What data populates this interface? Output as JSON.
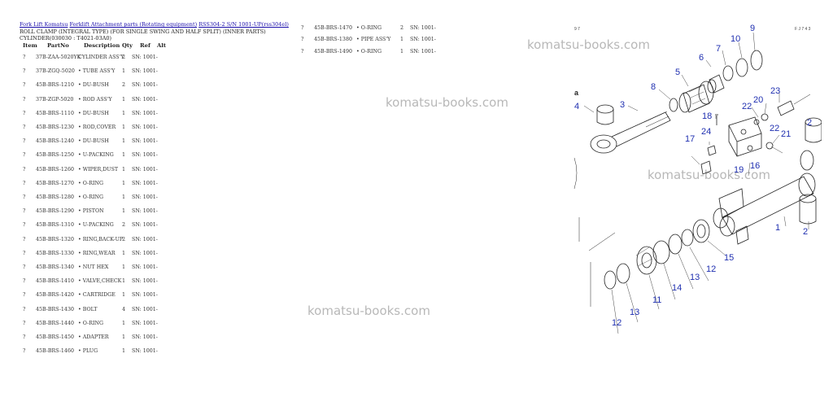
{
  "breadcrumb": [
    {
      "text": "Fork Lift Komatsu"
    },
    {
      "text": "Forklift Attachment parts (Rotating equipment)"
    },
    {
      "text": "RSS304-2 S/N 1001-UP(rss304el)"
    }
  ],
  "title_lines": [
    "ROLL CLAMP (INTEGRAL TYPE) (FOR SINGLE SWING AND HALF SPLIT) (INNER PARTS)",
    "CYLINDER(030030 : T4021-03A0)"
  ],
  "headers": {
    "item": "Item",
    "partno": "PartNo",
    "desc": "Description",
    "qty": "Qty",
    "ref": "Ref",
    "alt": "Alt"
  },
  "parts_left": [
    {
      "item": "?",
      "partno": "37B-ZAA-5020YK",
      "desc": "CYLINDER ASS'Y",
      "qty": "2",
      "ref": "SN: 1001-"
    },
    {
      "item": "?",
      "partno": "37B-ZGQ-5020",
      "desc": "• TUBE ASS'Y",
      "qty": "1",
      "ref": "SN: 1001-"
    },
    {
      "item": "?",
      "partno": "45B-BRS-1210",
      "desc": "• DU-BUSH",
      "qty": "2",
      "ref": "SN: 1001-"
    },
    {
      "item": "?",
      "partno": "37B-ZGP-5020",
      "desc": "• ROD ASS'Y",
      "qty": "1",
      "ref": "SN: 1001-"
    },
    {
      "item": "?",
      "partno": "45B-BRS-1110",
      "desc": "• DU-BUSH",
      "qty": "1",
      "ref": "SN: 1001-"
    },
    {
      "item": "?",
      "partno": "45B-BRS-1230",
      "desc": "• ROD,COVER",
      "qty": "1",
      "ref": "SN: 1001-"
    },
    {
      "item": "?",
      "partno": "45B-BRS-1240",
      "desc": "• DU-BUSH",
      "qty": "1",
      "ref": "SN: 1001-"
    },
    {
      "item": "?",
      "partno": "45B-BRS-1250",
      "desc": "• U-PACKING",
      "qty": "1",
      "ref": "SN: 1001-"
    },
    {
      "item": "?",
      "partno": "45B-BRS-1260",
      "desc": "• WIPER,DUST",
      "qty": "1",
      "ref": "SN: 1001-"
    },
    {
      "item": "?",
      "partno": "45B-BRS-1270",
      "desc": "• O-RING",
      "qty": "1",
      "ref": "SN: 1001-"
    },
    {
      "item": "?",
      "partno": "45B-BRS-1280",
      "desc": "• O-RING",
      "qty": "1",
      "ref": "SN: 1001-"
    },
    {
      "item": "?",
      "partno": "45B-BRS-1290",
      "desc": "• PISTON",
      "qty": "1",
      "ref": "SN: 1001-"
    },
    {
      "item": "?",
      "partno": "45B-BRS-1310",
      "desc": "• U-PACKING",
      "qty": "2",
      "ref": "SN: 1001-"
    },
    {
      "item": "?",
      "partno": "45B-BRS-1320",
      "desc": "• RING,BACK-UP",
      "qty": "2",
      "ref": "SN: 1001-"
    },
    {
      "item": "?",
      "partno": "45B-BRS-1330",
      "desc": "• RING,WEAR",
      "qty": "1",
      "ref": "SN: 1001-"
    },
    {
      "item": "?",
      "partno": "45B-BRS-1340",
      "desc": "• NUT HEX",
      "qty": "1",
      "ref": "SN: 1001-"
    },
    {
      "item": "?",
      "partno": "45B-BRS-1410",
      "desc": "• VALVE,CHECK",
      "qty": "1",
      "ref": "SN: 1001-"
    },
    {
      "item": "?",
      "partno": "45B-BRS-1420",
      "desc": "• CARTRIDGE",
      "qty": "1",
      "ref": "SN: 1001-"
    },
    {
      "item": "?",
      "partno": "45B-BRS-1430",
      "desc": "• BOLT",
      "qty": "4",
      "ref": "SN: 1001-"
    },
    {
      "item": "?",
      "partno": "45B-BRS-1440",
      "desc": "• O-RING",
      "qty": "1",
      "ref": "SN: 1001-"
    },
    {
      "item": "?",
      "partno": "45B-BRS-1450",
      "desc": "• ADAPTER",
      "qty": "1",
      "ref": "SN: 1001-"
    },
    {
      "item": "?",
      "partno": "45B-BRS-1460",
      "desc": "• PLUG",
      "qty": "1",
      "ref": "SN: 1001-"
    }
  ],
  "parts_right": [
    {
      "item": "?",
      "partno": "45B-BRS-1470",
      "desc": "• O-RING",
      "qty": "2",
      "ref": "SN: 1001-"
    },
    {
      "item": "?",
      "partno": "45B-BRS-1380",
      "desc": "• PIPE ASS'Y",
      "qty": "1",
      "ref": "SN: 1001-"
    },
    {
      "item": "?",
      "partno": "45B-BRS-1490",
      "desc": "• O-RING",
      "qty": "1",
      "ref": "SN: 1001-"
    }
  ],
  "watermark": "komatsu-books.com",
  "diagram": {
    "corner_left": "9 7",
    "corner_right": "F J 7 4 3",
    "side_letter": "a",
    "callouts": [
      "1",
      "2",
      "2",
      "3",
      "4",
      "5",
      "6",
      "7",
      "8",
      "9",
      "10",
      "11",
      "12",
      "12",
      "12",
      "13",
      "13",
      "14",
      "15",
      "16",
      "17",
      "18",
      "19",
      "20",
      "21",
      "22",
      "22",
      "23",
      "24"
    ]
  },
  "colors": {
    "link": "#1a0dab",
    "callout": "#1f2fb0",
    "watermark": "#b8b8b8"
  }
}
